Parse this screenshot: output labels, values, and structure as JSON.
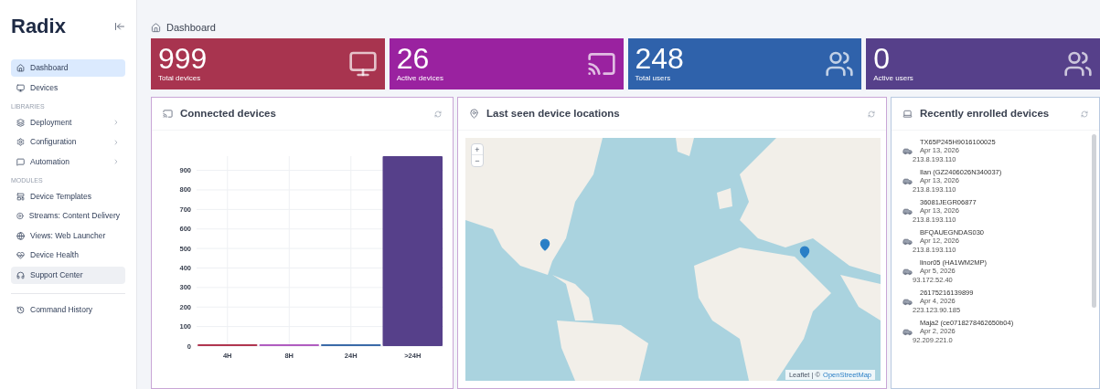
{
  "sidebar": {
    "logo": "Radix",
    "items": [
      {
        "kind": "item",
        "label": "Dashboard",
        "selected": true,
        "hovered": false,
        "expandable": false
      },
      {
        "kind": "item",
        "label": "Devices",
        "selected": false,
        "hovered": false,
        "expandable": false
      },
      {
        "kind": "section",
        "label": "LIBRARIES"
      },
      {
        "kind": "item",
        "label": "Deployment",
        "selected": false,
        "hovered": false,
        "expandable": true
      },
      {
        "kind": "item",
        "label": "Configuration",
        "selected": false,
        "hovered": false,
        "expandable": true
      },
      {
        "kind": "item",
        "label": "Automation",
        "selected": false,
        "hovered": false,
        "expandable": true
      },
      {
        "kind": "section",
        "label": "MODULES"
      },
      {
        "kind": "item",
        "label": "Device Templates",
        "selected": false,
        "hovered": false,
        "expandable": false
      },
      {
        "kind": "item",
        "label": "Streams: Content Delivery",
        "selected": false,
        "hovered": false,
        "expandable": false
      },
      {
        "kind": "item",
        "label": "Views: Web Launcher",
        "selected": false,
        "hovered": false,
        "expandable": false
      },
      {
        "kind": "item",
        "label": "Device Health",
        "selected": false,
        "hovered": false,
        "expandable": false
      },
      {
        "kind": "item",
        "label": "Support Center",
        "selected": false,
        "hovered": true,
        "expandable": false
      },
      {
        "kind": "divider"
      },
      {
        "kind": "item",
        "label": "Command History",
        "selected": false,
        "hovered": false,
        "expandable": false
      }
    ]
  },
  "breadcrumb": "Dashboard",
  "stats": [
    {
      "value": "999",
      "label": "Total devices",
      "color": "#a8344f"
    },
    {
      "value": "26",
      "label": "Active devices",
      "color": "#9a22a0"
    },
    {
      "value": "248",
      "label": "Total users",
      "color": "#2f62ab"
    },
    {
      "value": "0",
      "label": "Active users",
      "color": "#56408a"
    }
  ],
  "connected": {
    "title": "Connected devices",
    "chart_data": {
      "type": "bar",
      "series": [
        {
          "name": "4H",
          "color": "#b0354f",
          "values": [
            8,
            null,
            null,
            null
          ]
        },
        {
          "name": "8H",
          "color": "#b05cc0",
          "values": [
            null,
            3,
            null,
            null
          ]
        },
        {
          "name": "24H",
          "color": "#3a6aa8",
          "values": [
            null,
            null,
            5,
            null
          ]
        },
        {
          "name": ">24H",
          "color": "#56408a",
          "values": [
            null,
            null,
            null,
            973
          ]
        }
      ],
      "grid": true,
      "ylim": [
        0,
        973
      ],
      "yticks": [
        0,
        100,
        200,
        300,
        400,
        500,
        600,
        700,
        800,
        900
      ]
    }
  },
  "locations": {
    "title": "Last seen device locations",
    "zoom_in": "+",
    "zoom_out": "−",
    "attribution_prefix": "Leaflet | ©",
    "attribution_link": "OpenStreetMap"
  },
  "enrolled": {
    "title": "Recently enrolled devices",
    "devices": [
      {
        "name": "TX65P245H9016100025",
        "date": "Apr 13, 2026",
        "ip": "213.8.193.110"
      },
      {
        "name": "Ilan (GZ2406026N340037)",
        "date": "Apr 13, 2026",
        "ip": "213.8.193.110"
      },
      {
        "name": "36081JEGR06877",
        "date": "Apr 13, 2026",
        "ip": "213.8.193.110"
      },
      {
        "name": "BFQAUEGNDAS030",
        "date": "Apr 12, 2026",
        "ip": "213.8.193.110"
      },
      {
        "name": "linor05 (HA1WM2MP)",
        "date": "Apr 5, 2026",
        "ip": "93.172.52.40"
      },
      {
        "name": "26175216139899",
        "date": "Apr 4, 2026",
        "ip": "223.123.90.185"
      },
      {
        "name": "Maja2 (ce0718278462650b04)",
        "date": "Apr 2, 2026",
        "ip": "92.209.221.0"
      }
    ]
  }
}
